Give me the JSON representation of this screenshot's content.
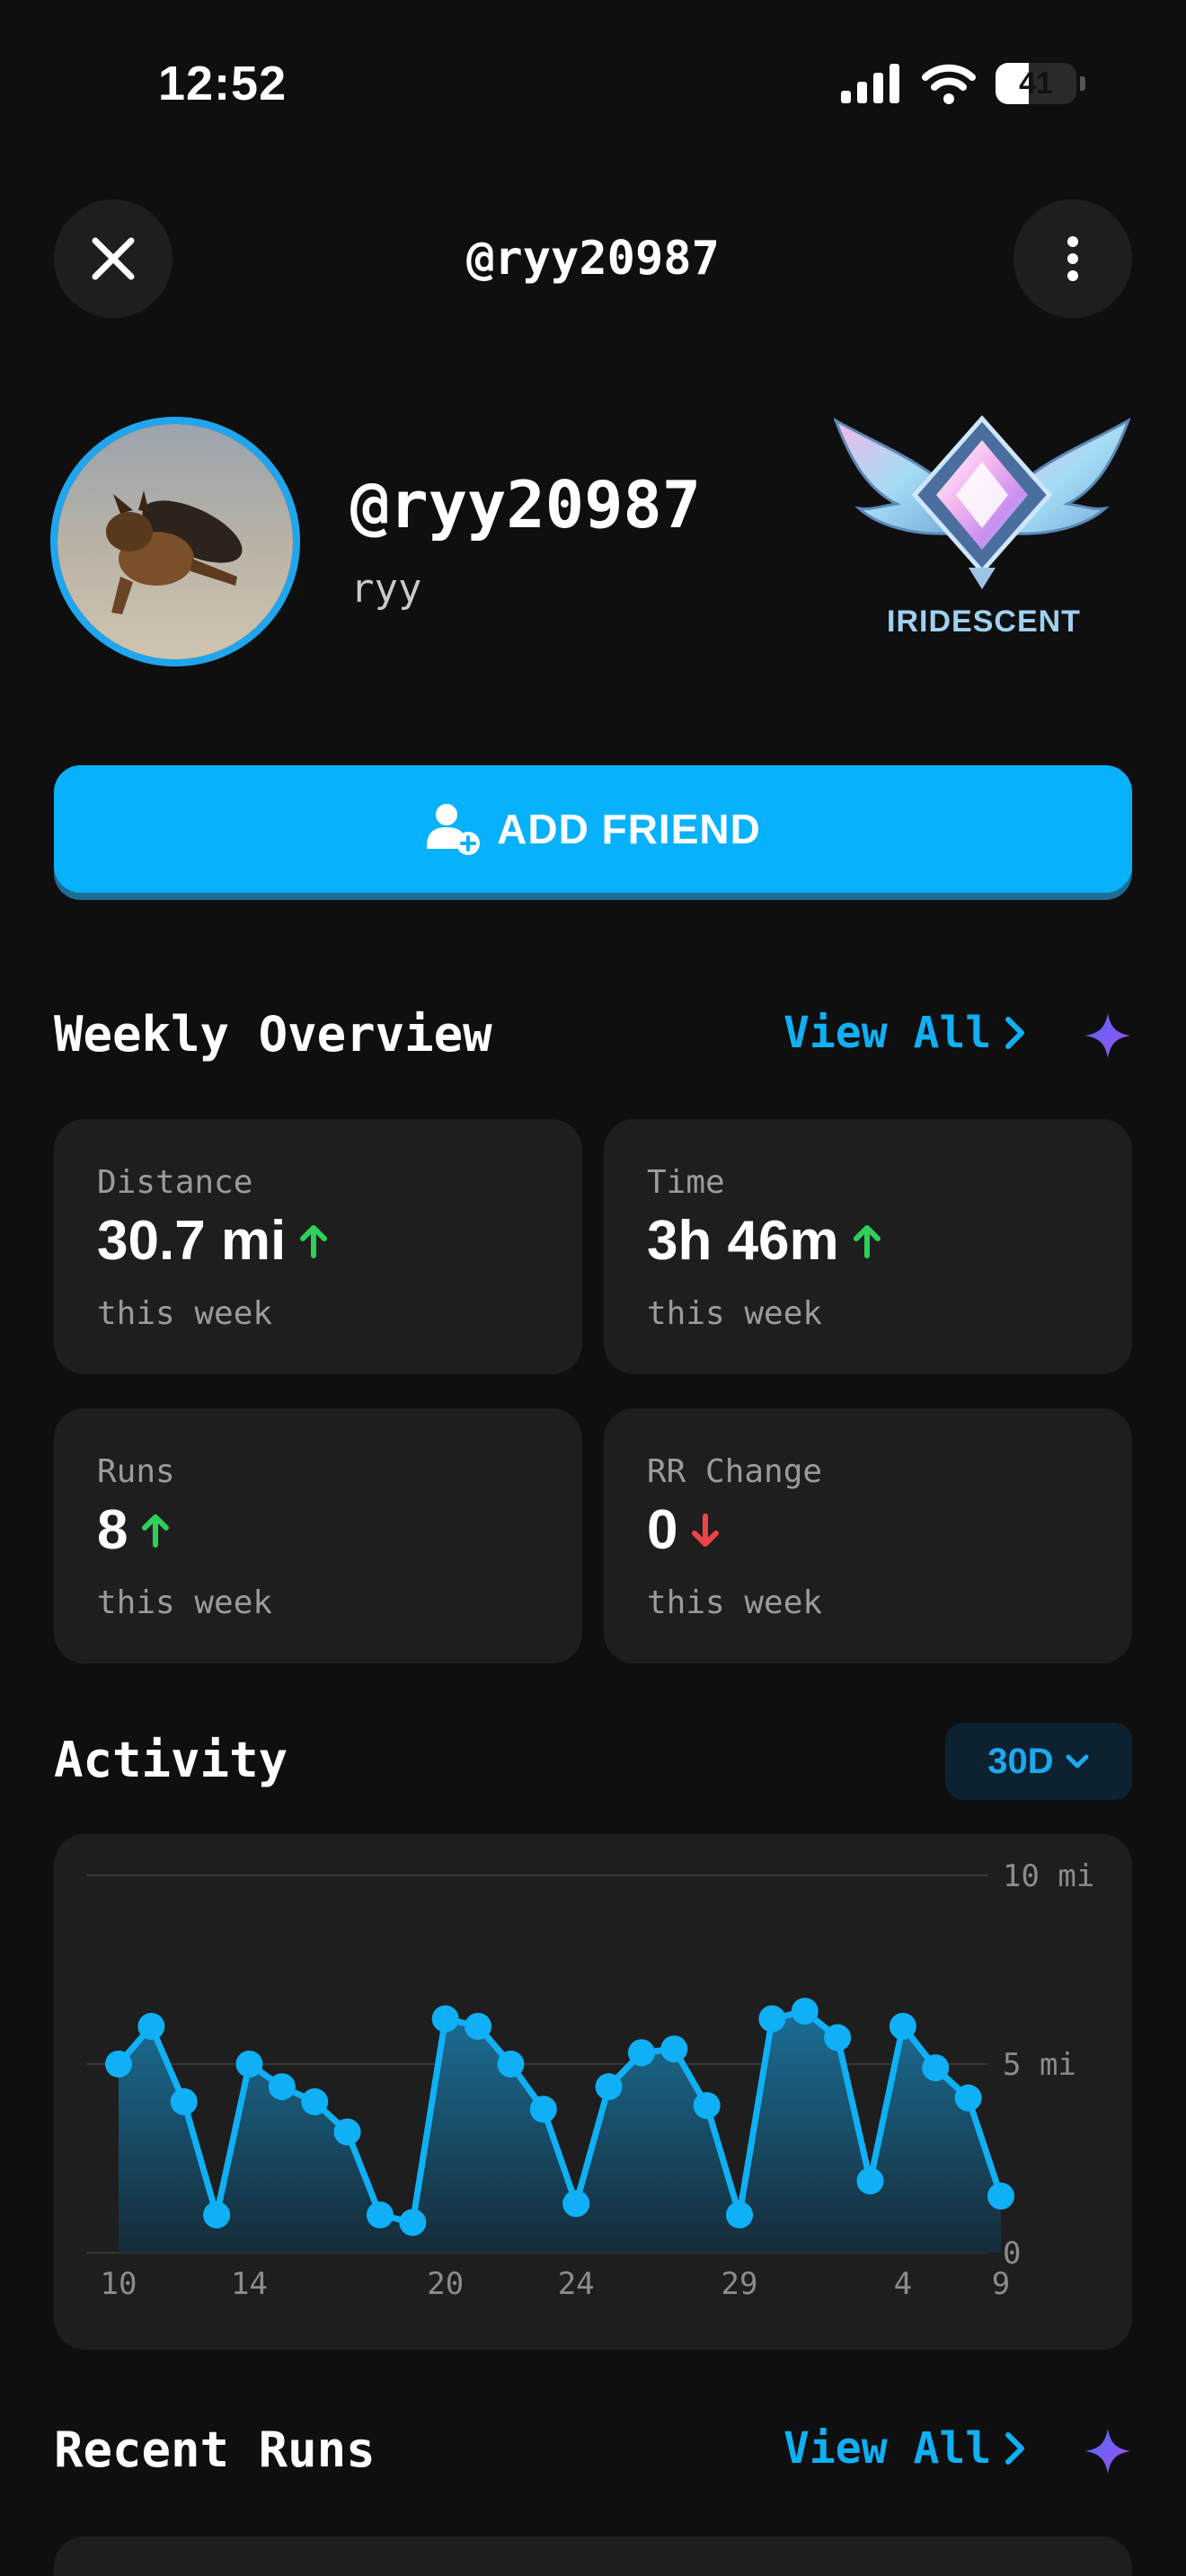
{
  "status_bar": {
    "time": "12:52",
    "battery": "41"
  },
  "header": {
    "title": "@ryy20987"
  },
  "profile": {
    "username": "@ryy20987",
    "display_name": "ryy",
    "rank_label": "IRIDESCENT"
  },
  "add_friend": {
    "label": "ADD FRIEND"
  },
  "weekly_overview": {
    "title": "Weekly Overview",
    "view_all": "View All",
    "cards": [
      {
        "label": "Distance",
        "value": "30.7 mi",
        "trend": "up",
        "sub": "this week"
      },
      {
        "label": "Time",
        "value": "3h 46m",
        "trend": "up",
        "sub": "this week"
      },
      {
        "label": "Runs",
        "value": "8",
        "trend": "up",
        "sub": "this week"
      },
      {
        "label": "RR Change",
        "value": "0",
        "trend": "down",
        "sub": "this week"
      }
    ]
  },
  "activity": {
    "title": "Activity",
    "range": "30D"
  },
  "chart_data": {
    "type": "area",
    "x_tick_labels": [
      "10",
      "14",
      "20",
      "24",
      "29",
      "4",
      "9"
    ],
    "y_tick_labels": [
      "0",
      "5 mi",
      "10 mi"
    ],
    "ylim": [
      0,
      10
    ],
    "values": [
      5.0,
      6.0,
      4.0,
      1.0,
      5.0,
      4.4,
      4.0,
      3.2,
      1.0,
      0.8,
      6.2,
      6.0,
      5.0,
      3.8,
      1.3,
      4.4,
      5.3,
      5.4,
      3.9,
      1.0,
      6.2,
      6.4,
      5.7,
      1.9,
      6.0,
      4.9,
      4.1,
      1.5
    ],
    "colors": {
      "line": "#0fb0f5",
      "fill_top": "#1b6e96",
      "fill_bottom": "#152b38"
    },
    "grid": true
  },
  "recent_runs": {
    "title": "Recent Runs",
    "view_all": "View All"
  }
}
